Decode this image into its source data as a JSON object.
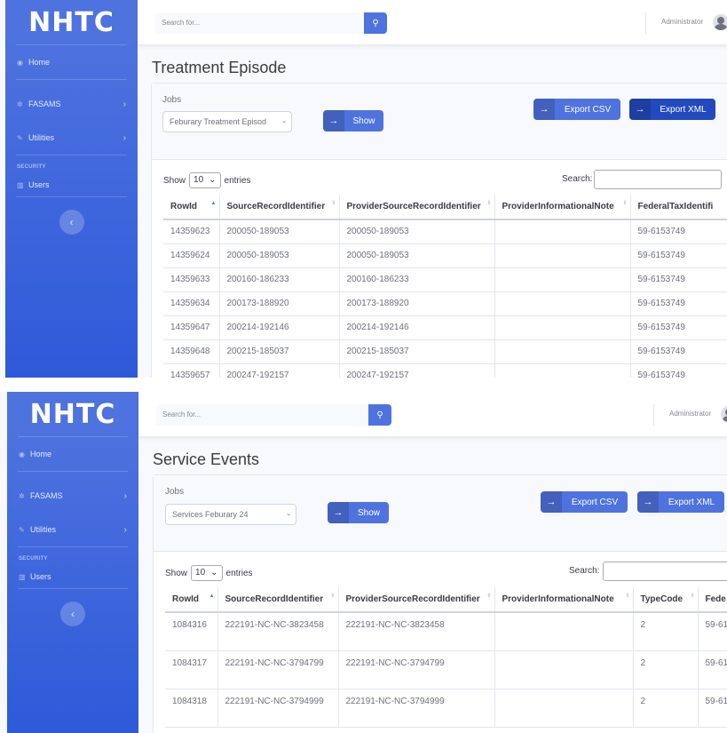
{
  "colors": {
    "primary": "#4e73df",
    "primary_dark": "#224abe",
    "text": "#3a3b45",
    "muted": "#858796"
  },
  "sidebar": {
    "brand": "NHTC",
    "items": [
      {
        "label": "Home",
        "icon": "dashboard-icon"
      },
      {
        "label": "FASAMS",
        "icon": "gear-icon"
      },
      {
        "label": "Utilities",
        "icon": "wrench-icon"
      }
    ],
    "heading": "SECURITY",
    "users_label": "Users",
    "toggle_icon": "‹"
  },
  "topbar": {
    "search_placeholder": "Search for...",
    "search_icon": "🔍",
    "user": "Administrator"
  },
  "screens": [
    {
      "title": "Treatment Episode",
      "jobs_label": "Jobs",
      "selected_job": "Feburary Treatment Episod",
      "show_button": "Show",
      "export_csv": "Export CSV",
      "export_xml": "Export XML",
      "show_label": "Show",
      "entries_value": "10",
      "entries_label": "entries",
      "search_label": "Search:",
      "columns": [
        "RowId",
        "SourceRecordIdentifier",
        "ProviderSourceRecordIdentifier",
        "ProviderInformationalNote",
        "FederalTaxIdentifi"
      ],
      "rows": [
        [
          "14359623",
          "200050-189053",
          "200050-189053",
          "",
          "59-6153749"
        ],
        [
          "14359624",
          "200050-189053",
          "200050-189053",
          "",
          "59-6153749"
        ],
        [
          "14359633",
          "200160-186233",
          "200160-186233",
          "",
          "59-6153749"
        ],
        [
          "14359634",
          "200173-188920",
          "200173-188920",
          "",
          "59-6153749"
        ],
        [
          "14359647",
          "200214-192146",
          "200214-192146",
          "",
          "59-6153749"
        ],
        [
          "14359648",
          "200215-185037",
          "200215-185037",
          "",
          "59-6153749"
        ],
        [
          "14359657",
          "200247-192157",
          "200247-192157",
          "",
          "59-6153749"
        ]
      ]
    },
    {
      "title": "Service Events",
      "jobs_label": "Jobs",
      "selected_job": "Services Feburary 24",
      "show_button": "Show",
      "export_csv": "Export CSV",
      "export_xml": "Export XML",
      "show_label": "Show",
      "entries_value": "10",
      "entries_label": "entries",
      "search_label": "Search:",
      "columns": [
        "RowId",
        "SourceRecordIdentifier",
        "ProviderSourceRecordIdentifier",
        "ProviderInformationalNote",
        "TypeCode",
        "Fede"
      ],
      "rows": [
        [
          "1084316",
          "222191-NC-NC-3823458",
          "222191-NC-NC-3823458",
          "",
          "2",
          "59-61"
        ],
        [
          "1084317",
          "222191-NC-NC-3794799",
          "222191-NC-NC-3794799",
          "",
          "2",
          "59-61"
        ],
        [
          "1084318",
          "222191-NC-NC-3794999",
          "222191-NC-NC-3794999",
          "",
          "2",
          "59-61"
        ]
      ]
    }
  ]
}
